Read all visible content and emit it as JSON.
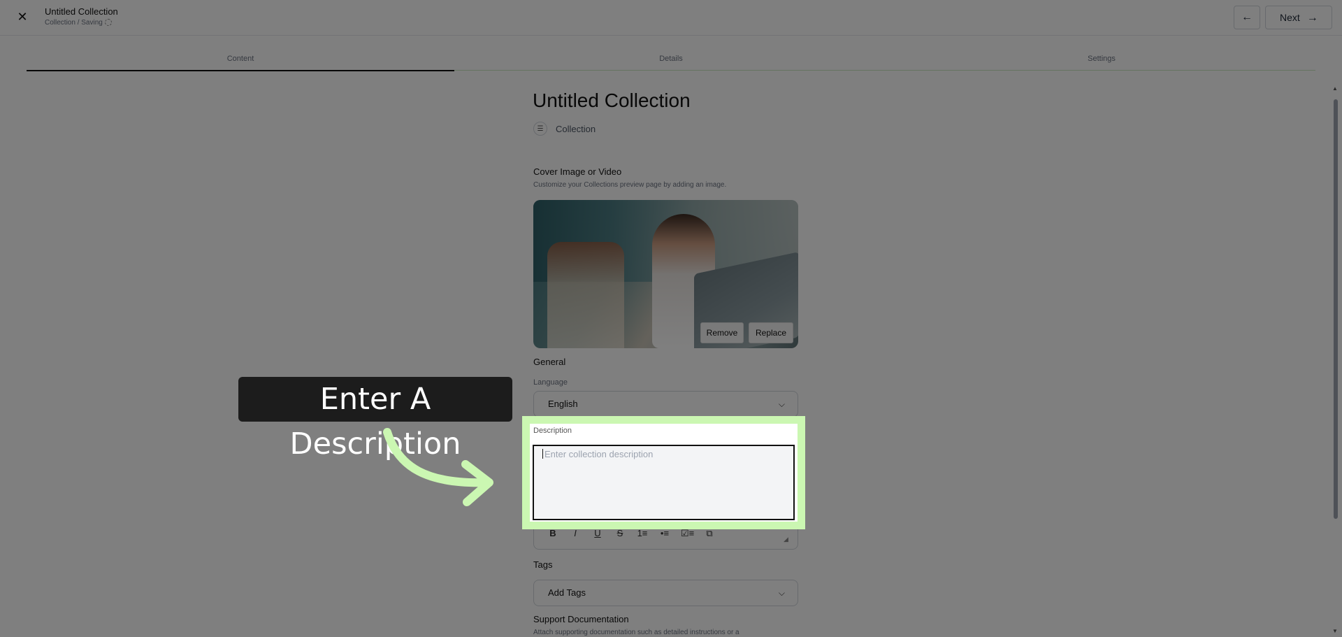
{
  "header": {
    "close_icon": "close-icon",
    "title": "Untitled Collection",
    "subtitle": "Collection / Saving",
    "back_icon": "arrow-left-icon",
    "next_label": "Next",
    "next_icon": "arrow-right-icon"
  },
  "tabs": [
    {
      "label": "Content",
      "active": true
    },
    {
      "label": "Details",
      "active": false
    },
    {
      "label": "Settings",
      "active": false
    }
  ],
  "main": {
    "title": "Untitled Collection",
    "type_label": "Collection",
    "type_icon": "collection-stack-icon",
    "cover": {
      "label": "Cover Image or Video",
      "help": "Customize your Collections preview page by adding an image.",
      "remove_label": "Remove",
      "replace_label": "Replace"
    },
    "general": {
      "heading": "General",
      "language_label": "Language",
      "language_value": "English"
    },
    "description": {
      "label": "Description",
      "placeholder": "Enter collection description",
      "toolbar": [
        "B",
        "I",
        "U",
        "S",
        "1≡",
        "•≡",
        "☑≡",
        "⧉"
      ]
    },
    "tags": {
      "label": "Tags",
      "placeholder": "Add Tags"
    },
    "support": {
      "label": "Support Documentation",
      "help": "Attach supporting documentation such as detailed instructions or a"
    }
  },
  "annotation": {
    "callout": "Enter A Description",
    "accent": "#cbf7b2"
  }
}
